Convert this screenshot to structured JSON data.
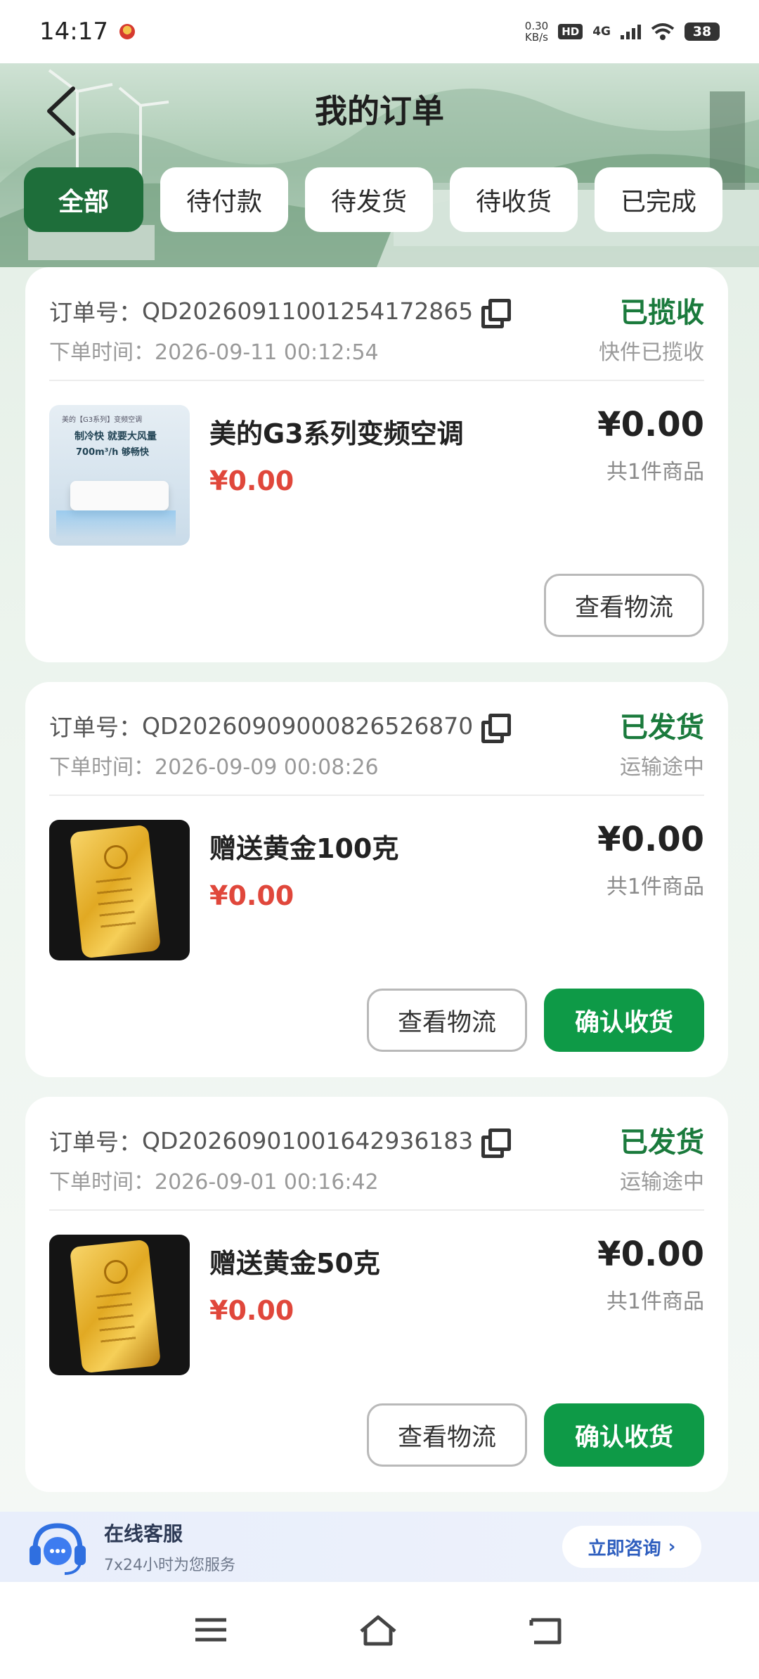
{
  "status_bar": {
    "time": "14:17",
    "speed": "0.30",
    "speed_unit": "KB/s",
    "hd": "HD",
    "network": "4G",
    "battery": "38"
  },
  "header": {
    "title": "我的订单"
  },
  "tabs": [
    {
      "label": "全部",
      "active": true
    },
    {
      "label": "待付款",
      "active": false
    },
    {
      "label": "待发货",
      "active": false
    },
    {
      "label": "待收货",
      "active": false
    },
    {
      "label": "已完成",
      "active": false
    }
  ],
  "orders": [
    {
      "order_label": "订单号：",
      "order_no": "QD20260911001254172865",
      "time_label": "下单时间：",
      "time": "2026-09-11 00:12:54",
      "status": "已揽收",
      "substatus": "快件已揽收",
      "product_name": "美的G3系列变频空调",
      "product_price": "¥0.00",
      "total": "¥0.00",
      "count": "共1件商品",
      "buttons": [
        "查看物流"
      ],
      "thumb": {
        "brand": "美的【G3系列】变频空调",
        "line1": "制冷快 就要大风量",
        "line2": "700m³/h 够畅快"
      }
    },
    {
      "order_label": "订单号：",
      "order_no": "QD20260909000826526870",
      "time_label": "下单时间：",
      "time": "2026-09-09 00:08:26",
      "status": "已发货",
      "substatus": "运输途中",
      "product_name": "赠送黄金100克",
      "product_price": "¥0.00",
      "total": "¥0.00",
      "count": "共1件商品",
      "buttons": [
        "查看物流",
        "确认收货"
      ]
    },
    {
      "order_label": "订单号：",
      "order_no": "QD20260901001642936183",
      "time_label": "下单时间：",
      "time": "2026-09-01 00:16:42",
      "status": "已发货",
      "substatus": "运输途中",
      "product_name": "赠送黄金50克",
      "product_price": "¥0.00",
      "total": "¥0.00",
      "count": "共1件商品",
      "buttons": [
        "查看物流",
        "确认收货"
      ]
    }
  ],
  "service": {
    "title": "在线客服",
    "subtitle": "7x24小时为您服务",
    "button": "立即咨询"
  },
  "colors": {
    "accent_green": "#1e6e3a",
    "status_green": "#1a7a3c",
    "confirm_green": "#0e9a47",
    "price_red": "#e0473b"
  }
}
